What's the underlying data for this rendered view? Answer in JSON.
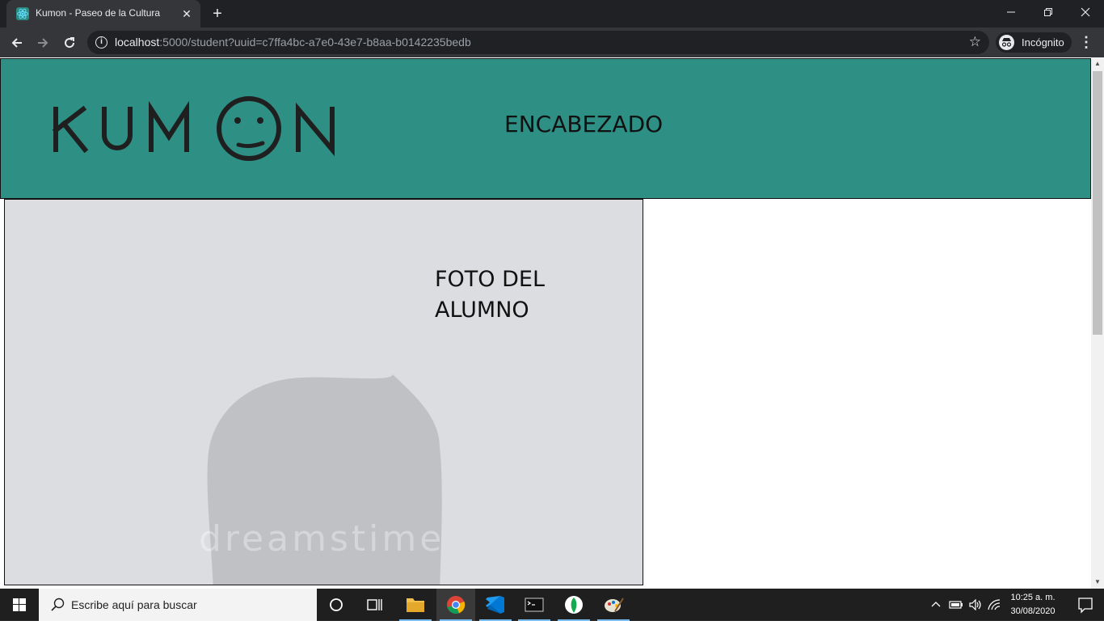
{
  "browser": {
    "tab_title": "Kumon - Paseo de la Cultura",
    "tab_close": "✕",
    "new_tab": "+",
    "url_host": "localhost",
    "url_rest": ":5000/student?uuid=c7ffa4bc-a7e0-43e7-b8aa-b0142235bedb",
    "profile_label": "Incógnito",
    "window_controls": {
      "minimize": "—",
      "restore": "❐",
      "close": "✕"
    }
  },
  "page": {
    "header_title": "ENCABEZADO",
    "logo_text": "KUMON",
    "photo_label": "FOTO DEL ALUMNO",
    "photo_watermark": "dreamstime"
  },
  "taskbar": {
    "search_placeholder": "Escribe aquí para buscar",
    "clock_time": "10:25 a. m.",
    "clock_date": "30/08/2020",
    "pinned_apps": [
      "cortana-icon",
      "task-view-icon",
      "file-explorer-icon",
      "chrome-icon",
      "vscode-icon",
      "terminal-icon",
      "mongodb-icon",
      "paint-icon"
    ]
  },
  "colors": {
    "header_bg": "#2e8f85",
    "photo_bg": "#dcdde0",
    "chrome_dark": "#202124",
    "chrome_toolbar": "#35363a",
    "taskbar_bg": "#1f1f1f"
  }
}
